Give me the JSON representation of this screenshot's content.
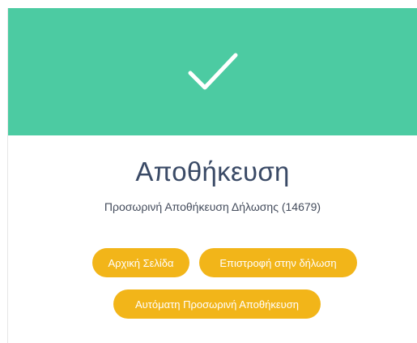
{
  "dialog": {
    "title": "Αποθήκευση",
    "message": "Προσωρινή Αποθήκευση Δήλωσης (14679)",
    "icon": "checkmark-icon",
    "header_color": "#4ccba2",
    "button_color": "#f2b519"
  },
  "buttons": {
    "home_label": "Αρχική Σελίδα",
    "return_label": "Επιστροφή στην δήλωση",
    "autosave_label": "Αυτόματη Προσωρινή Αποθήκευση"
  }
}
